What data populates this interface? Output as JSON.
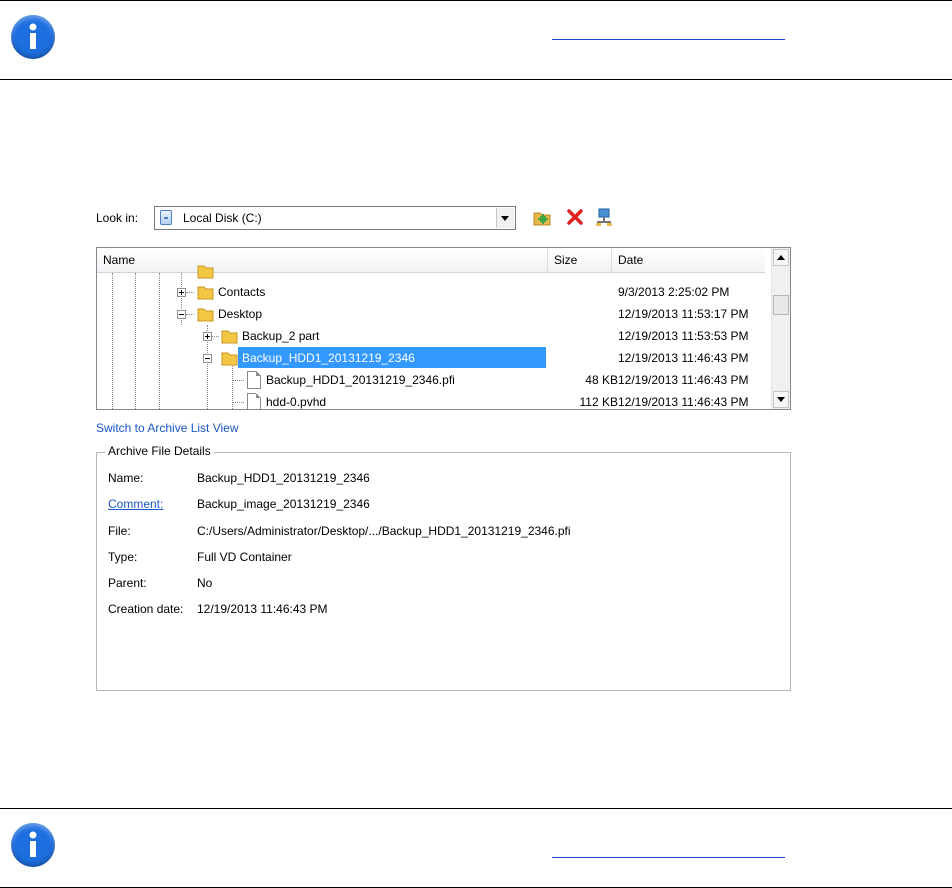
{
  "dialog": {
    "look_in_label": "Look in:",
    "look_in_value": "Local Disk (C:)",
    "toolbar": [
      "new-folder-icon",
      "delete-icon",
      "network-icon"
    ],
    "columns": {
      "name": "Name",
      "size": "Size",
      "date": "Date"
    },
    "rows": [
      {
        "name": "Contacts",
        "size": "",
        "date": "9/3/2013 2:25:02 PM"
      },
      {
        "name": "Desktop",
        "size": "",
        "date": "12/19/2013 11:53:17 PM"
      },
      {
        "name": "Backup_2 part",
        "size": "",
        "date": "12/19/2013 11:53:53 PM"
      },
      {
        "name": "Backup_HDD1_20131219_2346",
        "size": "",
        "date": "12/19/2013 11:46:43 PM"
      },
      {
        "name": "Backup_HDD1_20131219_2346.pfi",
        "size": "48 KB",
        "date": "12/19/2013 11:46:43 PM"
      },
      {
        "name": "hdd-0.pvhd",
        "size": "112 KB",
        "date": "12/19/2013 11:46:43 PM"
      }
    ],
    "switch_link": "Switch to Archive List View",
    "details": {
      "title": "Archive File Details",
      "name_label": "Name:",
      "name_value": "Backup_HDD1_20131219_2346",
      "comment_label": "Comment:",
      "comment_value": "Backup_image_20131219_2346",
      "file_label": "File:",
      "file_value": "C:/Users/Administrator/Desktop/.../Backup_HDD1_20131219_2346.pfi",
      "type_label": "Type:",
      "type_value": "Full VD Container",
      "parent_label": "Parent:",
      "parent_value": "No",
      "created_label": "Creation date:",
      "created_value": "12/19/2013 11:46:43 PM"
    }
  },
  "colors": {
    "info_icon": "#1d6fe0",
    "selection": "#3399ff",
    "link": "#1a57c8"
  }
}
